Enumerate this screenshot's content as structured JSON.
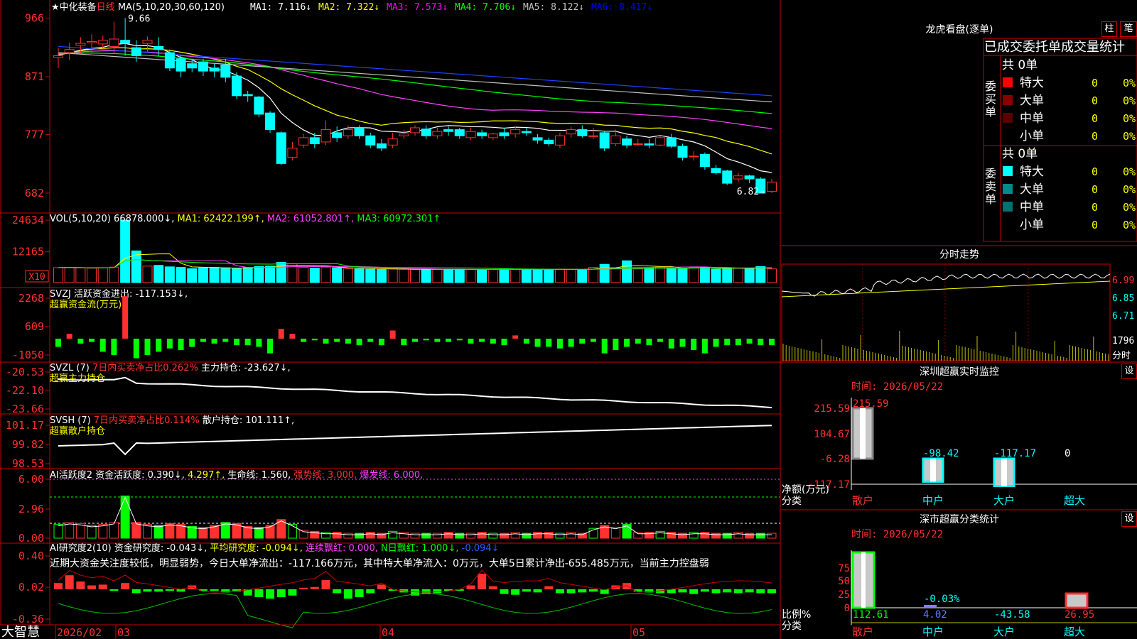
{
  "header": {
    "stock_name": "中化装备",
    "period": "日线",
    "ma_label": "MA(5,10,20,30,60,120)",
    "ma_values": [
      {
        "label": "MA1:",
        "value": "7.116",
        "color": "#ffffff"
      },
      {
        "label": "MA2:",
        "value": "7.322",
        "color": "#ffff00"
      },
      {
        "label": "MA3:",
        "value": "7.573",
        "color": "#ff00ff"
      },
      {
        "label": "MA4:",
        "value": "7.706",
        "color": "#00ff00"
      },
      {
        "label": "MA5:",
        "value": "8.122",
        "color": "#c0c0c0"
      },
      {
        "label": "MA6:",
        "value": "8.417",
        "color": "#0000ff"
      }
    ],
    "high_label": "9.66",
    "low_label": "6.82"
  },
  "price_axis": [
    "966",
    "871",
    "777",
    "682"
  ],
  "vol_header": {
    "label": "VOL(5,10,20)",
    "vol": "66878.000",
    "ma1": "62422.199",
    "ma2": "61052.801",
    "ma3": "60972.301"
  },
  "vol_axis": [
    "24634",
    "12165"
  ],
  "vol_unit": "X10",
  "svzj": {
    "label": "SVZJ",
    "title": "活跃资金进出:",
    "value": "-117.153",
    "subtitle": "超赢资金流(万元)",
    "axis": [
      "2268",
      "609",
      "-1050"
    ]
  },
  "svzl": {
    "label": "SVZL (7)",
    "desc": "7日内买卖净占比0.262%",
    "title": "主力持仓:",
    "value": "-23.627",
    "subtitle": "超赢主力持仓",
    "axis": [
      "-20.53",
      "-22.10",
      "-23.66"
    ]
  },
  "svsh": {
    "label": "SVSH (7)",
    "desc": "7日内买卖净占比0.114%",
    "title": "散户持仓:",
    "value": "101.111",
    "subtitle": "超赢散户持仓",
    "axis": [
      "101.17",
      "99.82",
      "98.53"
    ]
  },
  "ai_active": {
    "label": "AI活跃度2",
    "title": "资金活跃度:",
    "v1": "0.390",
    "v2": "4.297",
    "life": "生命线: 1.560,",
    "strong": "强势线: 3.000,",
    "burst": "爆发线: 6.000,",
    "axis": [
      "6.00",
      "2.96",
      "0.00"
    ]
  },
  "ai_research": {
    "label": "AI研究度2(10)",
    "title": "资金研究度:",
    "v1": "-0.043",
    "avg": "平均研究度: -0.094",
    "cont": "连续飘红: 0.000,",
    "nday": "N日飘红: 1.000",
    "v2": "-0.094",
    "comment": "近期大资金关注度较低，明显弱势，今日大单净流出：-117.166万元，其中特大单净流入：0万元，大单5日累计净出-655.485万元，当前主力控盘弱",
    "axis": [
      "0.40",
      "0.02",
      "-0.36"
    ]
  },
  "date_axis": [
    "2026/02",
    "03",
    "04",
    "05"
  ],
  "brand": "大智慧",
  "right_panel": {
    "dragon_title": "龙虎看盘(逐单)",
    "btn_zhu": "柱",
    "btn_bi": "笔",
    "stats_title": "已成交委托单成交量统计",
    "buy_label": "委买单",
    "sell_label": "委卖单",
    "buy_total": "共 0单",
    "sell_total": "共 0单",
    "buy_rows": [
      {
        "name": "特大",
        "count": "0",
        "pct": "0%",
        "color": "#ff0000"
      },
      {
        "name": "大单",
        "count": "0",
        "pct": "0%",
        "color": "#8b0000"
      },
      {
        "name": "中单",
        "count": "0",
        "pct": "0%",
        "color": "#5a0000"
      },
      {
        "name": "小单",
        "count": "0",
        "pct": "0%",
        "color": "#000000"
      }
    ],
    "sell_rows": [
      {
        "name": "特大",
        "count": "0",
        "pct": "0%",
        "color": "#00ffff"
      },
      {
        "name": "大单",
        "count": "0",
        "pct": "0%",
        "color": "#008b8b"
      },
      {
        "name": "中单",
        "count": "0",
        "pct": "0%",
        "color": "#007070"
      },
      {
        "name": "小单",
        "count": "0",
        "pct": "0%",
        "color": "#000000"
      }
    ],
    "intraday_title": "分时走势",
    "intraday_axis": [
      "6.99",
      "6.85",
      "6.71",
      "1796"
    ],
    "intraday_unit": "分时",
    "sz_title": "深圳超赢实时监控",
    "sz_btn": "设",
    "sz_time": "时间: 2026/05/22",
    "sz_axis": [
      "215.59",
      "104.67",
      "-6.28",
      "-117.17"
    ],
    "sz_ylabel": "净额(万元)",
    "sz_xlabel": "分类",
    "sz_cats": [
      "散户",
      "中户",
      "大户",
      "超大"
    ],
    "sz_values": [
      "215.59",
      "-98.42",
      "-117.17",
      "0"
    ],
    "sm_title": "深市超赢分类统计",
    "sm_btn": "设",
    "sm_time": "时间: 2026/05/22",
    "sm_axis": [
      "75",
      "50",
      "25",
      "0"
    ],
    "sm_ylabel": "比例%",
    "sm_xlabel": "分类",
    "sm_cats": [
      "散户",
      "中户",
      "大户",
      "超大"
    ],
    "sm_values": [
      "112.61",
      "4.02",
      "-43.58",
      "26.95"
    ],
    "sm_top_label": "-0.03%"
  },
  "chart_data": [
    {
      "type": "candlestick",
      "title": "中化装备 日线",
      "ylim": [
        6.82,
        9.66
      ],
      "candles": [
        [
          9.02,
          9.05,
          9.18,
          8.85
        ],
        [
          9.1,
          9.15,
          9.26,
          8.98
        ],
        [
          9.22,
          9.25,
          9.35,
          9.08
        ],
        [
          9.26,
          9.28,
          9.4,
          9.1
        ],
        [
          9.24,
          9.3,
          9.38,
          9.15
        ],
        [
          9.2,
          9.32,
          9.6,
          9.08
        ],
        [
          9.3,
          9.25,
          9.66,
          9.05
        ],
        [
          9.18,
          9.05,
          9.3,
          8.95
        ],
        [
          9.25,
          9.3,
          9.36,
          9.12
        ],
        [
          9.2,
          9.15,
          9.35,
          9.05
        ],
        [
          9.1,
          8.85,
          9.15,
          8.8
        ],
        [
          9.0,
          8.8,
          9.05,
          8.7
        ],
        [
          8.92,
          8.85,
          8.98,
          8.78
        ],
        [
          8.95,
          8.8,
          9.0,
          8.72
        ],
        [
          8.85,
          8.8,
          8.92,
          8.7
        ],
        [
          8.9,
          8.7,
          9.0,
          8.62
        ],
        [
          8.72,
          8.4,
          8.78,
          8.35
        ],
        [
          8.42,
          8.4,
          8.48,
          8.3
        ],
        [
          8.38,
          8.1,
          8.4,
          8.05
        ],
        [
          8.12,
          7.85,
          8.15,
          7.8
        ],
        [
          7.8,
          7.3,
          7.82,
          7.28
        ],
        [
          7.4,
          7.55,
          7.65,
          7.35
        ],
        [
          7.6,
          7.72,
          7.78,
          7.55
        ],
        [
          7.72,
          7.62,
          7.8,
          7.55
        ],
        [
          7.65,
          7.85,
          8.0,
          7.6
        ],
        [
          7.8,
          7.72,
          7.9,
          7.65
        ],
        [
          7.75,
          7.85,
          7.92,
          7.7
        ],
        [
          7.88,
          7.75,
          7.92,
          7.7
        ],
        [
          7.75,
          7.6,
          7.8,
          7.55
        ],
        [
          7.62,
          7.55,
          7.7,
          7.5
        ],
        [
          7.6,
          7.7,
          7.8,
          7.55
        ],
        [
          7.75,
          7.78,
          7.85,
          7.7
        ],
        [
          7.8,
          7.88,
          7.92,
          7.75
        ],
        [
          7.86,
          7.75,
          7.92,
          7.7
        ],
        [
          7.75,
          7.82,
          7.88,
          7.7
        ],
        [
          7.85,
          7.82,
          7.9,
          7.75
        ],
        [
          7.85,
          7.75,
          7.88,
          7.7
        ],
        [
          7.72,
          7.82,
          7.88,
          7.68
        ],
        [
          7.8,
          7.75,
          7.85,
          7.7
        ],
        [
          7.72,
          7.78,
          7.8,
          7.68
        ],
        [
          7.8,
          7.75,
          7.88,
          7.7
        ],
        [
          7.78,
          7.85,
          7.9,
          7.72
        ],
        [
          7.82,
          7.8,
          7.88,
          7.75
        ],
        [
          7.72,
          7.68,
          7.78,
          7.62
        ],
        [
          7.68,
          7.62,
          7.72,
          7.58
        ],
        [
          7.6,
          7.75,
          7.8,
          7.55
        ],
        [
          7.78,
          7.85,
          7.9,
          7.72
        ],
        [
          7.85,
          7.75,
          7.92,
          7.72
        ],
        [
          7.75,
          7.75,
          7.88,
          7.7
        ],
        [
          7.8,
          7.55,
          7.82,
          7.5
        ],
        [
          7.62,
          7.75,
          7.85,
          7.58
        ],
        [
          7.7,
          7.6,
          7.75,
          7.55
        ],
        [
          7.62,
          7.62,
          7.7,
          7.58
        ],
        [
          7.62,
          7.6,
          7.7,
          7.55
        ],
        [
          7.6,
          7.72,
          7.75,
          7.58
        ],
        [
          7.72,
          7.58,
          7.78,
          7.55
        ],
        [
          7.58,
          7.4,
          7.62,
          7.35
        ],
        [
          7.42,
          7.42,
          7.5,
          7.35
        ],
        [
          7.45,
          7.25,
          7.48,
          7.2
        ],
        [
          7.22,
          7.15,
          7.28,
          7.12
        ],
        [
          7.18,
          6.98,
          7.2,
          6.95
        ],
        [
          7.05,
          7.1,
          7.15,
          7.0
        ],
        [
          7.1,
          7.05,
          7.12,
          6.98
        ],
        [
          7.05,
          6.82,
          7.08,
          6.82
        ],
        [
          6.85,
          7.0,
          7.05,
          6.82
        ]
      ],
      "ma_lines": [
        "MA1",
        "MA2",
        "MA3",
        "MA4",
        "MA5",
        "MA6"
      ]
    },
    {
      "type": "bar",
      "title": "VOL(5,10,20)",
      "unit": "X10",
      "values": [
        5900,
        6000,
        5800,
        5700,
        5900,
        6100,
        24634,
        12500,
        6500,
        6800,
        6200,
        6000,
        5500,
        5800,
        6000,
        5800,
        5500,
        5900,
        6300,
        6500,
        8000,
        7400,
        6000,
        5700,
        6100,
        5900,
        5600,
        5400,
        5300,
        5200,
        5400,
        5300,
        5200,
        5100,
        5200,
        5300,
        5300,
        5200,
        5100,
        5200,
        5300,
        5200,
        5100,
        5300,
        5200,
        5300,
        5200,
        5100,
        6000,
        7200,
        5800,
        8600,
        5400,
        5800,
        6100,
        5700,
        5400,
        5900,
        6000,
        5300,
        5600,
        5700,
        5600,
        6300,
        5400
      ],
      "ylim": [
        0,
        24634
      ]
    }
  ]
}
